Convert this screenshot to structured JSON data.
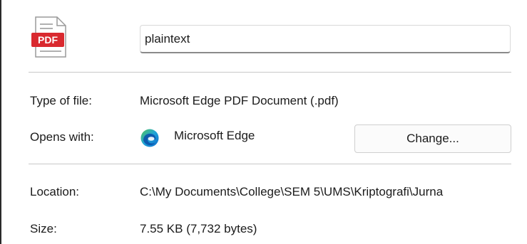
{
  "file": {
    "name_value": "plaintext",
    "icon_label": "PDF"
  },
  "properties": {
    "type_label": "Type of file:",
    "type_value": "Microsoft Edge PDF Document (.pdf)",
    "opens_label": "Opens with:",
    "opens_app": "Microsoft Edge",
    "change_label": "Change...",
    "location_label": "Location:",
    "location_value": "C:\\My Documents\\College\\SEM 5\\UMS\\Kriptografi\\Jurna",
    "size_label": "Size:",
    "size_value": "7.55 KB (7,732 bytes)"
  },
  "icons": {
    "file_icon": "pdf-file-icon",
    "app_icon": "microsoft-edge-icon"
  },
  "colors": {
    "pdf_red": "#d9292f",
    "edge_blue": "#0c67c9",
    "edge_green": "#52c45a"
  }
}
